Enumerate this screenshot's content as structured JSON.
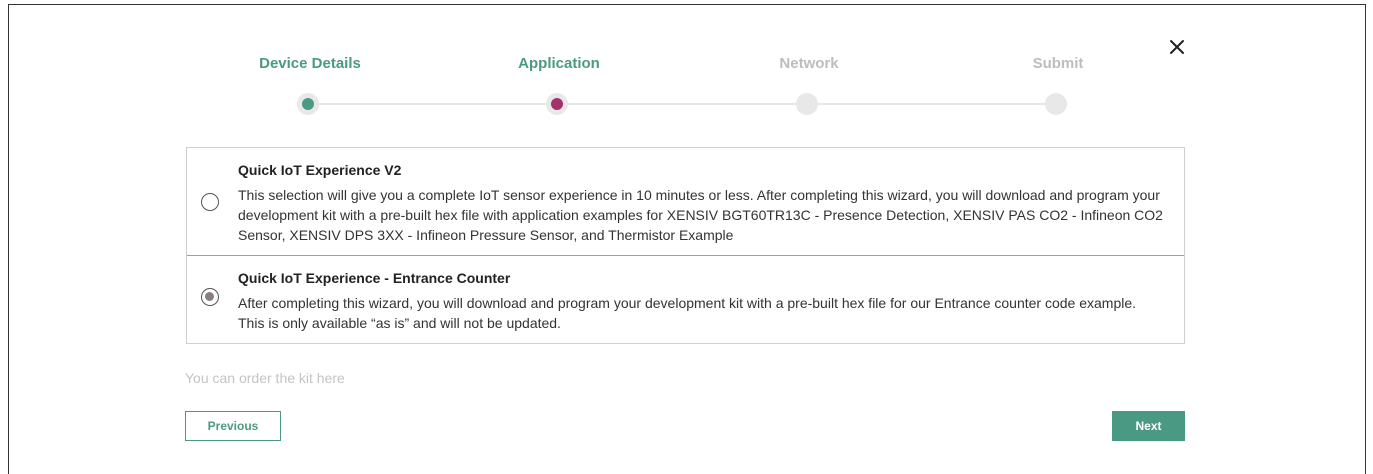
{
  "wizard": {
    "steps": [
      {
        "label": "Device Details",
        "state": "done",
        "color": "#4a9a83"
      },
      {
        "label": "Application",
        "state": "current",
        "color": "#a3316b"
      },
      {
        "label": "Network",
        "state": "pending"
      },
      {
        "label": "Submit",
        "state": "pending"
      }
    ],
    "close_icon": "close-icon"
  },
  "options": [
    {
      "title": "Quick IoT Experience V2",
      "description": "This selection will give you a complete IoT sensor experience in 10 minutes or less. After completing this wizard, you will download and program your development kit with a pre-built hex file with application examples for XENSIV BGT60TR13C - Presence Detection, XENSIV PAS CO2 - Infineon CO2 Sensor, XENSIV DPS 3XX - Infineon Pressure Sensor, and Thermistor Example",
      "selected": false
    },
    {
      "title": "Quick IoT Experience - Entrance Counter",
      "description": "After completing this wizard, you will download and program your development kit with a pre-built hex file for our Entrance counter code example. This is only available “as is” and will not be updated.",
      "selected": true
    }
  ],
  "order_link": "You can order the kit here",
  "buttons": {
    "previous": "Previous",
    "next": "Next"
  },
  "colors": {
    "accent": "#4a9a83",
    "current_step": "#a3316b",
    "inactive_text": "#bdbdbd"
  }
}
